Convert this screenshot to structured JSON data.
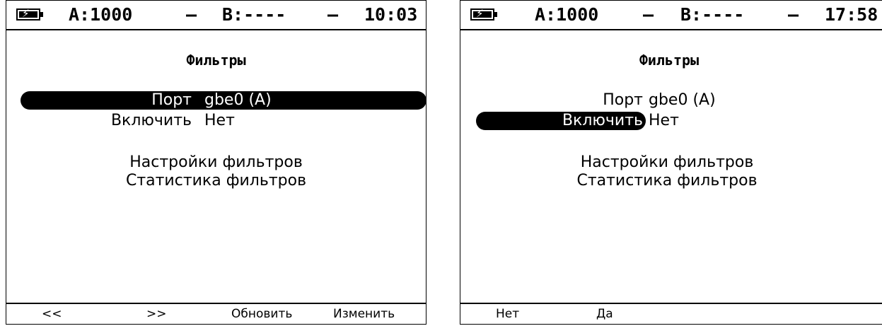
{
  "left": {
    "status": {
      "channel_a": "A:1000",
      "sep1": "–",
      "channel_b": "B:----",
      "sep2": "–",
      "time": "10:03"
    },
    "title": "Фильтры",
    "settings": [
      {
        "label": "Порт",
        "value": "gbe0 (A)"
      },
      {
        "label": "Включить",
        "value": "Нет"
      }
    ],
    "menu": [
      "Настройки фильтров",
      "Статистика фильтров"
    ],
    "softkeys": [
      "<<",
      ">>",
      "Обновить",
      "Изменить"
    ]
  },
  "right": {
    "status": {
      "channel_a": "A:1000",
      "sep1": "–",
      "channel_b": "B:----",
      "sep2": "–",
      "time": "17:58"
    },
    "title": "Фильтры",
    "settings": [
      {
        "label": "Порт",
        "value": "gbe0 (A)"
      },
      {
        "label": "Включить",
        "value": "Нет"
      }
    ],
    "menu": [
      "Настройки фильтров",
      "Статистика фильтров"
    ],
    "softkeys": [
      "Нет",
      "Да"
    ]
  }
}
